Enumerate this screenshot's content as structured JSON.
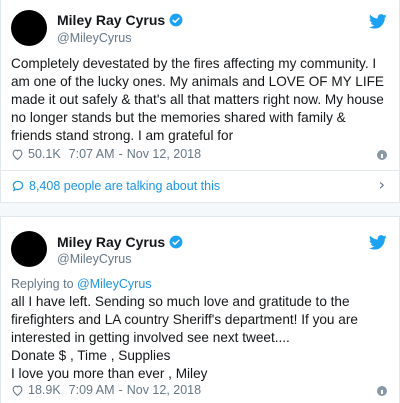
{
  "colors": {
    "accent": "#1da1f2",
    "link": "#1b95e0",
    "muted": "#657786",
    "text": "#14171a",
    "avatar": "#000000"
  },
  "tweets": [
    {
      "author_name": "Miley Ray Cyrus",
      "handle": "@MileyCyrus",
      "verified_icon": "verified-badge-icon",
      "logo_icon": "twitter-bird-icon",
      "text": "Completely devestated by the fires affecting my community. I am one of the lucky ones. My animals and LOVE OF MY LIFE made it out safely & that's all that matters right now. My house no longer stands but the memories shared with family & friends stand strong. I am grateful for",
      "likes": "50.1K",
      "time": "7:07 AM",
      "separator": "-",
      "date": "Nov 12, 2018",
      "talking": "8,408 people are talking about this"
    },
    {
      "author_name": "Miley Ray Cyrus",
      "handle": "@MileyCyrus",
      "verified_icon": "verified-badge-icon",
      "logo_icon": "twitter-bird-icon",
      "reply_prefix": "Replying to",
      "reply_to": "@MileyCyrus",
      "text_lines": [
        "all I have left. Sending so much love and gratitude to the",
        "firefighters and LA country Sheriff's department!  If you are",
        "interested in getting involved see next tweet....",
        "Donate $ , Time , Supplies",
        "I love you more than ever , Miley"
      ],
      "likes": "18.9K",
      "time": "7:09 AM",
      "separator": "-",
      "date": "Nov 12, 2018"
    }
  ]
}
